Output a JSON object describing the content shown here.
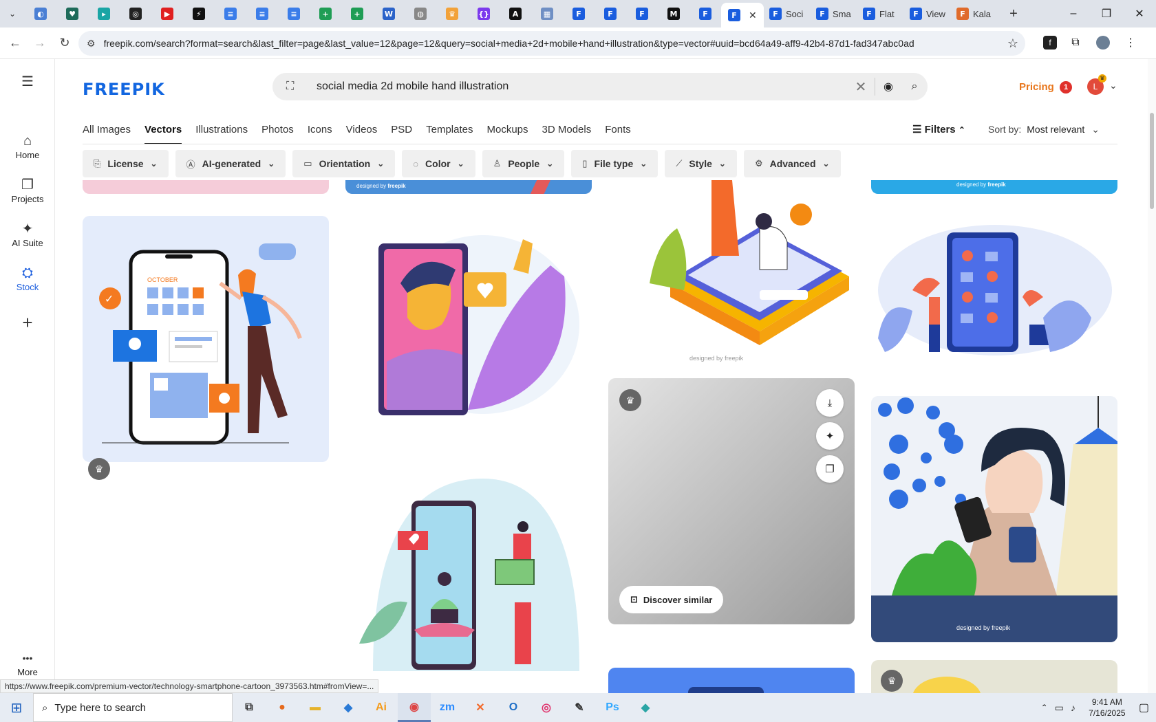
{
  "browser": {
    "tabs": [
      {
        "icon": "globe-tab-icon",
        "color": "#4a7fd4",
        "glyph": "◐"
      },
      {
        "icon": "shield-tab-icon",
        "color": "#1e6b5a",
        "glyph": "♥"
      },
      {
        "icon": "diamond-tab-icon",
        "color": "#1aa5a5",
        "glyph": "▸"
      },
      {
        "icon": "openai-tab-icon",
        "color": "#222222",
        "glyph": "◎"
      },
      {
        "icon": "youtube-tab-icon",
        "color": "#e02020",
        "glyph": "▶"
      },
      {
        "icon": "bolt-tab-icon",
        "color": "#111111",
        "glyph": "⚡"
      },
      {
        "icon": "docs-tab-icon",
        "color": "#3b7de9",
        "glyph": "≡"
      },
      {
        "icon": "docs-tab-icon",
        "color": "#3b7de9",
        "glyph": "≡"
      },
      {
        "icon": "docs-tab-icon",
        "color": "#3b7de9",
        "glyph": "≡"
      },
      {
        "icon": "sheets-tab-icon",
        "color": "#1f9d55",
        "glyph": "+"
      },
      {
        "icon": "sheets-tab-icon",
        "color": "#1f9d55",
        "glyph": "+"
      },
      {
        "icon": "word-tab-icon",
        "color": "#2b63c9",
        "glyph": "W"
      },
      {
        "icon": "globe-grey-tab-icon",
        "color": "#888888",
        "glyph": "◍"
      },
      {
        "icon": "crown-tab-icon",
        "color": "#f2a23a",
        "glyph": "♛"
      },
      {
        "icon": "code-tab-icon",
        "color": "#7c3aed",
        "glyph": "{}"
      },
      {
        "icon": "a-tab-icon",
        "color": "#111111",
        "glyph": "A"
      },
      {
        "icon": "grid-tab-icon",
        "color": "#6f8fc4",
        "glyph": "▦"
      },
      {
        "icon": "freepik-tab-icon",
        "color": "#1a5dde",
        "glyph": "F"
      },
      {
        "icon": "freepik-tab-icon",
        "color": "#1a5dde",
        "glyph": "F"
      },
      {
        "icon": "freepik-tab-icon",
        "color": "#1a5dde",
        "glyph": "F"
      },
      {
        "icon": "m-tab-icon",
        "color": "#111111",
        "glyph": "M"
      },
      {
        "icon": "freepik-tab-icon",
        "color": "#1a5dde",
        "glyph": "F"
      }
    ],
    "active_tab_close": "✕",
    "named_tabs": [
      {
        "title": "Soci",
        "color": "#1a5dde"
      },
      {
        "title": "Sma",
        "color": "#1a5dde"
      },
      {
        "title": "Flat",
        "color": "#1a5dde"
      },
      {
        "title": "View",
        "color": "#1a5dde"
      },
      {
        "title": "Kala",
        "color": "#e06b2b"
      }
    ],
    "new_tab": "+",
    "url": "freepik.com/search?format=search&last_filter=page&last_value=12&page=12&query=social+media+2d+mobile+hand+illustration&type=vector#uuid=bcd64a49-aff9-42b4-87d1-fad347abc0ad",
    "status_url": "https://www.freepik.com/premium-vector/technology-smartphone-cartoon_3973563.htm#fromView=..."
  },
  "rail": {
    "items": [
      {
        "label": "Home",
        "icon": "⌂"
      },
      {
        "label": "Projects",
        "icon": "❐"
      },
      {
        "label": "AI Suite",
        "icon": "✦"
      },
      {
        "label": "Stock",
        "icon": "⛭"
      }
    ],
    "add": "+",
    "more": "More",
    "more_icon": "•••"
  },
  "header": {
    "logo": "FREEPIK",
    "search_query": "social media 2d mobile hand illustration",
    "pricing": "Pricing",
    "notif_count": "1",
    "avatar_letter": "L"
  },
  "categories": [
    "All Images",
    "Vectors",
    "Illustrations",
    "Photos",
    "Icons",
    "Videos",
    "PSD",
    "Templates",
    "Mockups",
    "3D Models",
    "Fonts"
  ],
  "active_category": "Vectors",
  "filters_label": "Filters",
  "sort_label": "Sort by:",
  "sort_value": "Most relevant",
  "chips": [
    "License",
    "AI-generated",
    "Orientation",
    "Color",
    "People",
    "File type",
    "Style",
    "Advanced"
  ],
  "designed_by": "designed by",
  "freepik_mark": "freepik",
  "calendar_month": "OCTOBER",
  "discover_similar": "Discover similar",
  "taskbar": {
    "search_placeholder": "Type here to search",
    "time": "9:41 AM",
    "date": "7/16/2025"
  },
  "colors": {
    "brand": "#1266e0",
    "accent": "#e8761c"
  }
}
